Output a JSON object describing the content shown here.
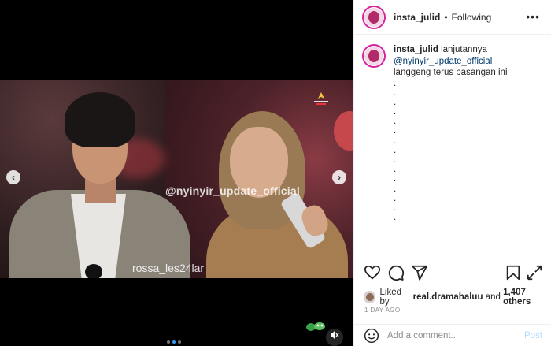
{
  "header": {
    "username": "insta_julid",
    "separator": "•",
    "follow_state": "Following",
    "more_icon": "more-horizontal-icon"
  },
  "caption": {
    "username": "insta_julid",
    "text": "lanjutannya",
    "mention": "@nyinyir_update_official",
    "line": "langgeng terus pasangan ini",
    "dots": [
      ".",
      ".",
      ".",
      ".",
      ".",
      ".",
      ".",
      ".",
      ".",
      ".",
      ".",
      ".",
      ".",
      ".",
      "."
    ]
  },
  "media": {
    "watermark_top": "@nyinyir_update_official",
    "watermark_bottom": "rossa_les24lar",
    "carousel_count": 3,
    "carousel_active_index": 1
  },
  "actions": {
    "like_icon": "heart-icon",
    "comment_icon": "comment-icon",
    "share_icon": "send-icon",
    "save_icon": "bookmark-icon"
  },
  "likes": {
    "prefix": "Liked by",
    "user": "real.dramahaluu",
    "connector": "and",
    "others": "1,407 others"
  },
  "timestamp": "1 DAY AGO",
  "comment_box": {
    "placeholder": "Add a comment...",
    "post_label": "Post"
  },
  "colors": {
    "link": "#00376b",
    "post_disabled": "#b3dbff",
    "carousel_active": "#3897f0",
    "avatar_ring": "#d6249f"
  }
}
